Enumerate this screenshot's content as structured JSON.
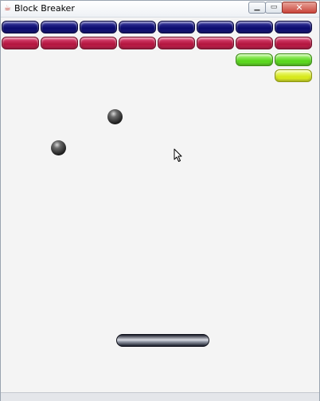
{
  "window": {
    "title": "Block Breaker",
    "icon": "java-cup-icon",
    "controls": {
      "minimize": "minimize-icon",
      "maximize": "maximize-icon",
      "close": "close-icon"
    }
  },
  "game": {
    "brick_rows": [
      {
        "color": "blue",
        "count": 8
      },
      {
        "color": "red",
        "count": 8
      },
      {
        "color": "green",
        "count": 2
      },
      {
        "color": "yellow",
        "count": 1
      }
    ],
    "balls": 2,
    "paddle": "paddle",
    "colors": {
      "blue": "#0b0b6e",
      "red": "#b3163f",
      "green": "#58d61c",
      "yellow": "#d6e81a",
      "background": "#f4f4f4"
    }
  }
}
